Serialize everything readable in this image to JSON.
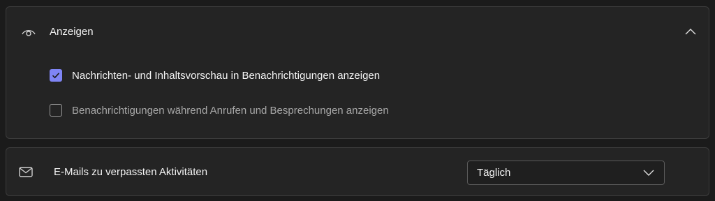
{
  "display_section": {
    "icon": "eye-icon",
    "title": "Anzeigen",
    "toggle_icon": "chevron-up-icon",
    "options": [
      {
        "label": "Nachrichten- und Inhaltsvorschau in Benachrichtigungen anzeigen",
        "checked": true,
        "enabled": true
      },
      {
        "label": "Benachrichtigungen während Anrufen und Besprechungen anzeigen",
        "checked": false,
        "enabled": false
      }
    ]
  },
  "email_section": {
    "icon": "mail-icon",
    "label": "E-Mails zu verpassten Aktivitäten",
    "dropdown": {
      "selected": "Täglich",
      "icon": "chevron-down-icon"
    }
  },
  "colors": {
    "accent": "#7f85f5",
    "background": "#1b1b1b",
    "card": "#242424",
    "border": "#3c3c3c"
  }
}
